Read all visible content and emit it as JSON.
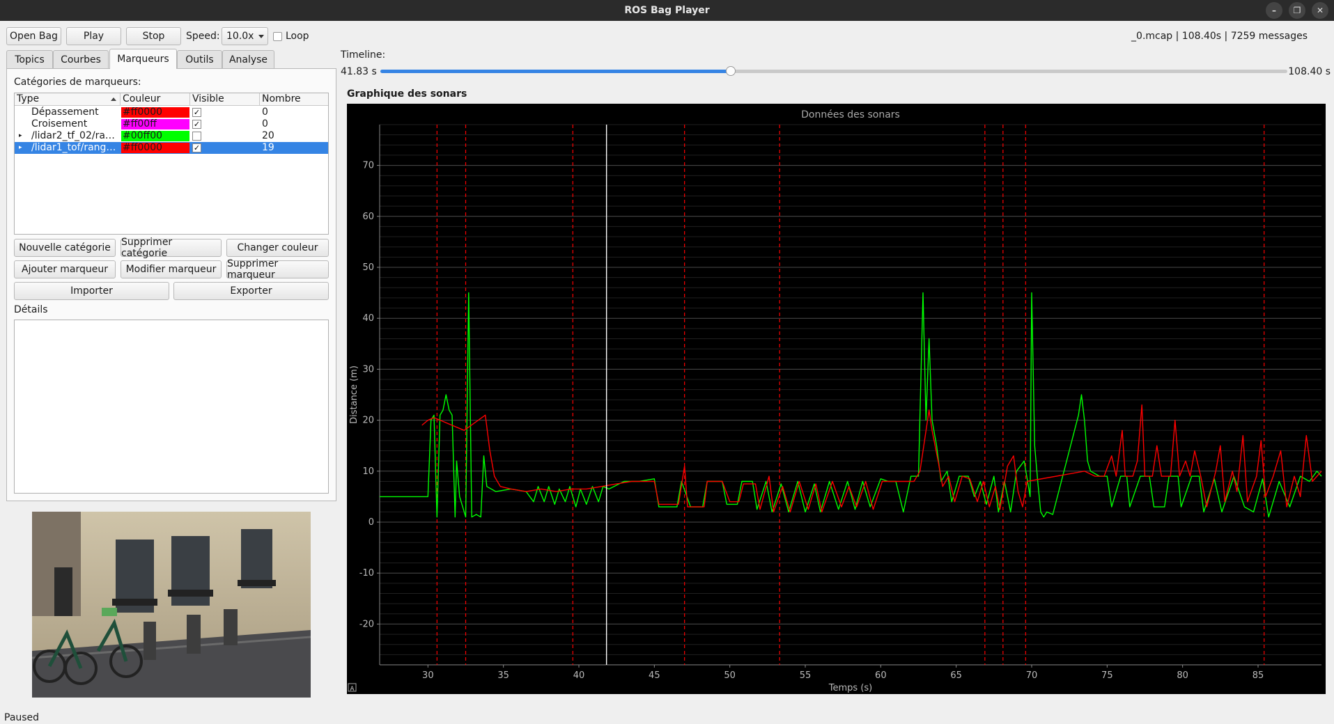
{
  "window": {
    "title": "ROS Bag Player",
    "minimize_glyph": "–",
    "maximize_glyph": "❐",
    "close_glyph": "✕"
  },
  "toolbar": {
    "open_label": "Open Bag",
    "play_label": "Play",
    "stop_label": "Stop",
    "speed_label": "Speed:",
    "speed_value": "10.0x",
    "loop_label": "Loop",
    "loop_checked": false,
    "file_info": "_0.mcap | 108.40s | 7259 messages"
  },
  "tabs": [
    {
      "label": "Topics"
    },
    {
      "label": "Courbes"
    },
    {
      "label": "Marqueurs",
      "active": true
    },
    {
      "label": "Outils"
    },
    {
      "label": "Analyse"
    }
  ],
  "markers": {
    "categories_label": "Catégories de marqueurs:",
    "columns": [
      "Type",
      "Couleur",
      "Visible",
      "Nombre"
    ],
    "rows": [
      {
        "type": "Dépassement",
        "color": "#ff0000",
        "visible": true,
        "count": "0",
        "expandable": false,
        "selected": false
      },
      {
        "type": "Croisement",
        "color": "#ff00ff",
        "visible": true,
        "count": "0",
        "expandable": false,
        "selected": false
      },
      {
        "type": "/lidar2_tf_02/ra…",
        "color": "#00ff00",
        "visible": false,
        "count": "20",
        "expandable": true,
        "selected": false
      },
      {
        "type": "/lidar1_tof/rang…",
        "color": "#ff0000",
        "visible": true,
        "count": "19",
        "expandable": true,
        "selected": true
      }
    ],
    "buttons": {
      "new_category": "Nouvelle catégorie",
      "delete_category": "Supprimer catégorie",
      "change_color": "Changer couleur",
      "add_marker": "Ajouter marqueur",
      "edit_marker": "Modifier marqueur",
      "delete_marker": "Supprimer marqueur",
      "import": "Importer",
      "export": "Exporter"
    },
    "details_label": "Détails",
    "check_glyph": "✓"
  },
  "timeline": {
    "label": "Timeline:",
    "current": "41.83 s",
    "end": "108.40 s",
    "position": 0.386
  },
  "chart_section_label": "Graphique des sonars",
  "chart_data": {
    "type": "line",
    "title": "Données des sonars",
    "xlabel": "Temps (s)",
    "ylabel": "Distance (m)",
    "xlim": [
      26.8,
      89.2
    ],
    "ylim": [
      -28,
      78
    ],
    "xticks": [
      30,
      35,
      40,
      45,
      50,
      55,
      60,
      65,
      70,
      75,
      80,
      85
    ],
    "yticks": [
      -20,
      -10,
      0,
      10,
      20,
      30,
      40,
      50,
      60,
      70
    ],
    "grid": true,
    "background": "#000000",
    "cursor_x": 41.83,
    "cursor_color": "#ffffff",
    "marker_color": "#ff0000",
    "marker_lines_x": [
      30.6,
      32.5,
      39.6,
      47.0,
      53.3,
      66.9,
      68.1,
      69.6,
      85.4
    ],
    "corner_button_glyph": "A",
    "series": [
      {
        "color": "#00ff00",
        "points": [
          [
            26.8,
            5
          ],
          [
            28.5,
            5
          ],
          [
            30.0,
            5
          ],
          [
            30.2,
            20
          ],
          [
            30.4,
            21
          ],
          [
            30.6,
            1
          ],
          [
            30.8,
            21
          ],
          [
            31.0,
            22
          ],
          [
            31.2,
            25
          ],
          [
            31.4,
            22
          ],
          [
            31.6,
            21
          ],
          [
            31.8,
            1
          ],
          [
            31.9,
            12
          ],
          [
            32.1,
            5
          ],
          [
            32.3,
            3
          ],
          [
            32.5,
            1
          ],
          [
            32.7,
            45
          ],
          [
            32.9,
            1
          ],
          [
            33.2,
            1.5
          ],
          [
            33.5,
            1
          ],
          [
            33.7,
            13
          ],
          [
            33.9,
            7
          ],
          [
            34.5,
            6
          ],
          [
            35.5,
            6.5
          ],
          [
            36.5,
            6
          ],
          [
            37.0,
            4
          ],
          [
            37.3,
            7
          ],
          [
            37.7,
            4
          ],
          [
            38.0,
            7
          ],
          [
            38.4,
            3.5
          ],
          [
            38.7,
            6.5
          ],
          [
            39.1,
            4
          ],
          [
            39.4,
            7
          ],
          [
            39.8,
            3
          ],
          [
            40.1,
            6.5
          ],
          [
            40.5,
            3.5
          ],
          [
            40.9,
            7
          ],
          [
            41.3,
            4
          ],
          [
            41.6,
            7
          ],
          [
            42.0,
            6.5
          ],
          [
            43.0,
            8
          ],
          [
            44.0,
            8
          ],
          [
            45.0,
            8.5
          ],
          [
            45.3,
            3
          ],
          [
            46.5,
            3
          ],
          [
            46.8,
            8
          ],
          [
            47.4,
            3
          ],
          [
            48.2,
            3
          ],
          [
            48.5,
            8
          ],
          [
            49.5,
            8
          ],
          [
            49.8,
            3.5
          ],
          [
            50.5,
            3.5
          ],
          [
            50.8,
            8
          ],
          [
            51.5,
            8
          ],
          [
            51.8,
            2.5
          ],
          [
            52.4,
            8
          ],
          [
            52.8,
            2
          ],
          [
            53.4,
            7.5
          ],
          [
            53.9,
            2
          ],
          [
            54.5,
            8
          ],
          [
            55.0,
            2
          ],
          [
            55.6,
            7.5
          ],
          [
            56.0,
            2
          ],
          [
            56.6,
            8
          ],
          [
            57.2,
            2.5
          ],
          [
            57.8,
            8
          ],
          [
            58.3,
            2.5
          ],
          [
            58.8,
            8
          ],
          [
            59.3,
            3
          ],
          [
            60.0,
            8.5
          ],
          [
            60.5,
            8
          ],
          [
            61.0,
            8
          ],
          [
            61.5,
            2
          ],
          [
            62.0,
            9
          ],
          [
            62.5,
            9
          ],
          [
            62.8,
            45
          ],
          [
            63.0,
            20
          ],
          [
            63.2,
            36
          ],
          [
            63.4,
            20
          ],
          [
            63.7,
            15
          ],
          [
            64.0,
            8
          ],
          [
            64.4,
            10
          ],
          [
            64.7,
            4
          ],
          [
            65.2,
            9
          ],
          [
            65.8,
            9
          ],
          [
            66.2,
            5
          ],
          [
            66.6,
            8
          ],
          [
            67.0,
            3.5
          ],
          [
            67.5,
            9
          ],
          [
            67.8,
            2
          ],
          [
            68.2,
            8
          ],
          [
            68.6,
            2
          ],
          [
            69.0,
            10
          ],
          [
            69.5,
            12
          ],
          [
            69.9,
            5
          ],
          [
            70.0,
            45
          ],
          [
            70.2,
            15
          ],
          [
            70.4,
            8
          ],
          [
            70.6,
            2
          ],
          [
            70.8,
            1
          ],
          [
            71.0,
            2
          ],
          [
            71.4,
            1.5
          ],
          [
            73.1,
            21
          ],
          [
            73.3,
            25
          ],
          [
            73.5,
            20
          ],
          [
            73.7,
            12
          ],
          [
            73.9,
            10
          ],
          [
            74.5,
            9
          ],
          [
            75.0,
            9
          ],
          [
            75.3,
            3
          ],
          [
            75.9,
            9
          ],
          [
            76.3,
            9
          ],
          [
            76.5,
            3
          ],
          [
            77.2,
            9
          ],
          [
            77.8,
            9
          ],
          [
            78.1,
            3
          ],
          [
            78.8,
            3
          ],
          [
            79.1,
            9
          ],
          [
            79.7,
            9
          ],
          [
            79.9,
            3
          ],
          [
            80.6,
            9
          ],
          [
            81.1,
            9
          ],
          [
            81.4,
            2
          ],
          [
            82.1,
            8.5
          ],
          [
            82.6,
            2
          ],
          [
            83.4,
            9
          ],
          [
            84.1,
            3
          ],
          [
            84.7,
            2
          ],
          [
            85.3,
            8.5
          ],
          [
            85.7,
            1
          ],
          [
            86.4,
            8
          ],
          [
            87.1,
            3
          ],
          [
            87.8,
            9
          ],
          [
            88.4,
            8
          ],
          [
            88.9,
            10
          ],
          [
            89.2,
            9
          ]
        ]
      },
      {
        "color": "#ff0000",
        "points": [
          [
            29.6,
            19
          ],
          [
            30.0,
            20
          ],
          [
            30.4,
            20.5
          ],
          [
            32.4,
            18
          ],
          [
            33.8,
            21
          ],
          [
            34.1,
            14
          ],
          [
            34.4,
            9
          ],
          [
            34.8,
            7
          ],
          [
            35.5,
            6.5
          ],
          [
            36.5,
            6
          ],
          [
            37.5,
            6.5
          ],
          [
            38.5,
            6
          ],
          [
            39.5,
            6.5
          ],
          [
            40.5,
            6.5
          ],
          [
            41.5,
            7
          ],
          [
            42.5,
            7.5
          ],
          [
            43.5,
            8
          ],
          [
            44.5,
            8
          ],
          [
            45.0,
            8
          ],
          [
            45.3,
            3.5
          ],
          [
            46.6,
            3.5
          ],
          [
            47.0,
            11
          ],
          [
            47.2,
            3
          ],
          [
            48.3,
            3
          ],
          [
            48.5,
            8
          ],
          [
            49.5,
            8
          ],
          [
            50.0,
            4
          ],
          [
            50.6,
            4
          ],
          [
            50.9,
            7.5
          ],
          [
            51.7,
            7.5
          ],
          [
            52.0,
            2.5
          ],
          [
            52.6,
            9
          ],
          [
            52.9,
            2
          ],
          [
            53.5,
            7
          ],
          [
            54.0,
            2
          ],
          [
            54.6,
            8
          ],
          [
            55.2,
            2.5
          ],
          [
            55.7,
            7.5
          ],
          [
            56.1,
            2
          ],
          [
            56.8,
            8
          ],
          [
            57.4,
            3
          ],
          [
            57.9,
            7
          ],
          [
            58.4,
            3
          ],
          [
            59.0,
            8
          ],
          [
            59.5,
            2.5
          ],
          [
            60.1,
            8
          ],
          [
            60.6,
            8
          ],
          [
            61.1,
            8
          ],
          [
            62.2,
            8
          ],
          [
            62.6,
            10
          ],
          [
            63.2,
            22
          ],
          [
            63.4,
            18
          ],
          [
            63.8,
            12
          ],
          [
            64.1,
            7
          ],
          [
            64.5,
            9
          ],
          [
            64.9,
            4
          ],
          [
            65.4,
            9
          ],
          [
            65.9,
            8.5
          ],
          [
            66.4,
            4
          ],
          [
            66.8,
            8
          ],
          [
            67.2,
            3
          ],
          [
            67.6,
            7
          ],
          [
            67.9,
            2.5
          ],
          [
            68.4,
            11
          ],
          [
            68.8,
            13
          ],
          [
            69.1,
            6
          ],
          [
            69.4,
            3
          ],
          [
            69.7,
            8
          ],
          [
            73.5,
            10
          ],
          [
            74.2,
            9
          ],
          [
            74.8,
            9
          ],
          [
            75.3,
            13
          ],
          [
            75.6,
            9
          ],
          [
            76.0,
            18
          ],
          [
            76.2,
            9
          ],
          [
            76.7,
            9
          ],
          [
            77.0,
            12
          ],
          [
            77.3,
            23
          ],
          [
            77.5,
            9
          ],
          [
            78.0,
            9
          ],
          [
            78.3,
            15
          ],
          [
            78.6,
            9
          ],
          [
            79.2,
            9
          ],
          [
            79.5,
            20
          ],
          [
            79.8,
            9
          ],
          [
            80.2,
            12
          ],
          [
            80.5,
            9
          ],
          [
            80.8,
            14
          ],
          [
            81.2,
            9
          ],
          [
            81.6,
            3
          ],
          [
            82.2,
            10
          ],
          [
            82.5,
            15
          ],
          [
            82.8,
            4
          ],
          [
            83.3,
            10
          ],
          [
            83.6,
            6
          ],
          [
            84.0,
            17
          ],
          [
            84.3,
            4
          ],
          [
            84.9,
            9
          ],
          [
            85.2,
            16
          ],
          [
            85.5,
            5
          ],
          [
            86.0,
            9
          ],
          [
            86.5,
            14
          ],
          [
            86.9,
            3
          ],
          [
            87.4,
            9
          ],
          [
            87.8,
            5
          ],
          [
            88.2,
            17
          ],
          [
            88.6,
            8
          ],
          [
            89.2,
            10
          ]
        ]
      }
    ]
  },
  "status": "Paused"
}
